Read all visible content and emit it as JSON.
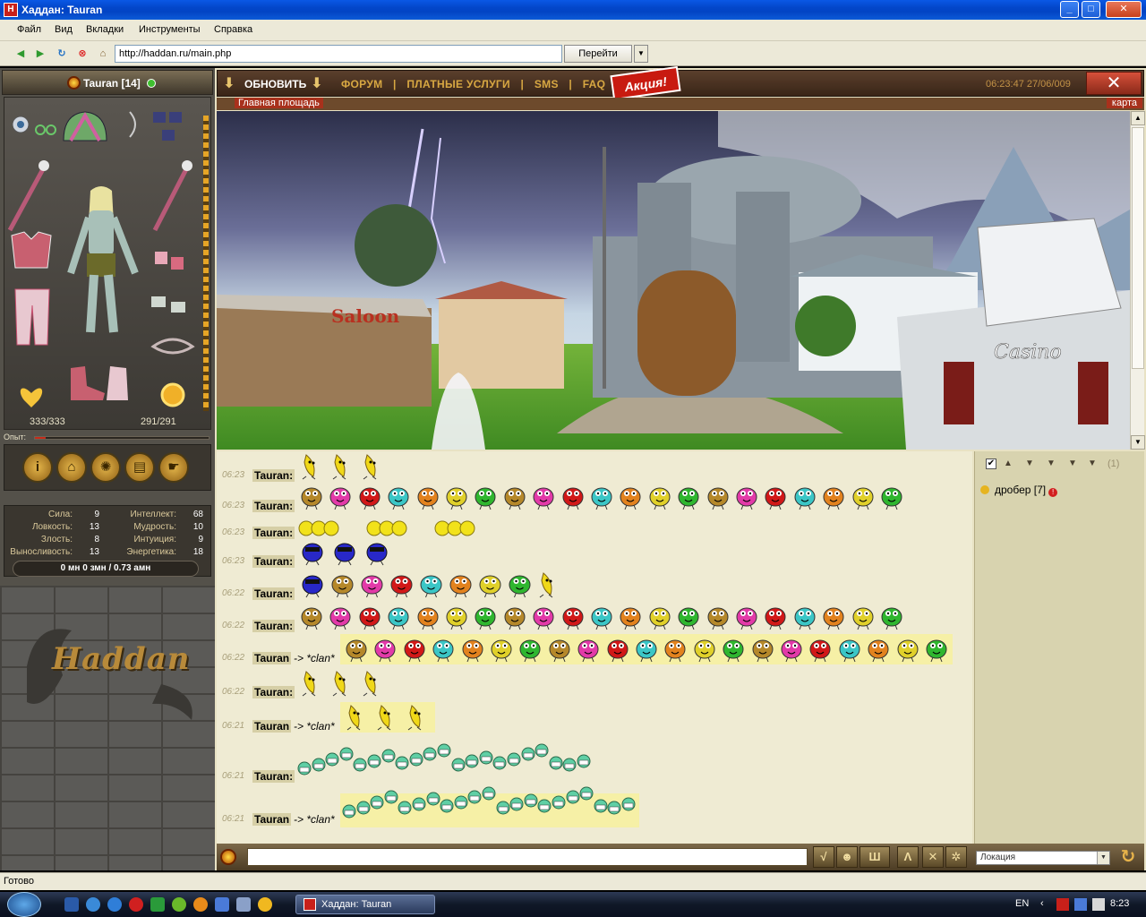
{
  "window": {
    "title": "Хаддан: Tauran",
    "app_icon": "H",
    "min_label": "_",
    "max_label": "□",
    "close_label": "✕"
  },
  "menu": [
    "Файл",
    "Вид",
    "Вкладки",
    "Инструменты",
    "Справка"
  ],
  "address": {
    "url": "http://haddan.ru/main.php",
    "go_label": "Перейти",
    "go_drop_label": "▼"
  },
  "nav_icons": [
    "back-icon",
    "forward-icon",
    "reload-icon",
    "stop-icon",
    "home-icon"
  ],
  "character": {
    "name": "Tauran [14]",
    "hp": "333/333",
    "mana": "291/291",
    "exp_label": "Опыт:",
    "exp_fraction": 0.06,
    "actions": [
      {
        "icon": "info-icon",
        "glyph": "i"
      },
      {
        "icon": "inventory-icon",
        "glyph": "⌂"
      },
      {
        "icon": "sun-icon",
        "glyph": "✺"
      },
      {
        "icon": "book-icon",
        "glyph": "▤"
      },
      {
        "icon": "hand-icon",
        "glyph": "☛"
      }
    ],
    "stats": [
      {
        "label": "Сила:",
        "value": "9"
      },
      {
        "label": "Ловкость:",
        "value": "13"
      },
      {
        "label": "Злость:",
        "value": "8"
      },
      {
        "label": "Выносливость:",
        "value": "13"
      },
      {
        "label": "Интеллект:",
        "value": "68"
      },
      {
        "label": "Мудрость:",
        "value": "10"
      },
      {
        "label": "Интуиция:",
        "value": "9"
      },
      {
        "label": "Энергетика:",
        "value": "18"
      }
    ],
    "money": "0 мн   0 змн / 0.73 амн",
    "logo": "Haddan"
  },
  "gamebar": {
    "refresh": "ОБНОВИТЬ",
    "arrow": "⬇",
    "links": [
      "ФОРУМ",
      "ПЛАТНЫЕ  УСЛУГИ",
      "SMS",
      "FAQ"
    ],
    "separator": "|",
    "promo": "Акция!",
    "time": "06:23:47   27/06/009",
    "close_glyph": "✕"
  },
  "location": {
    "name": "Главная площадь",
    "map_label": "карта"
  },
  "scene_labels": {
    "saloon": "Saloon",
    "casino": "Casino"
  },
  "chat": {
    "messages": [
      {
        "time": "06:23",
        "nick": "Tauran:",
        "to": "",
        "row": "bananas"
      },
      {
        "time": "06:23",
        "nick": "Tauran:",
        "to": "",
        "row": "creatures"
      },
      {
        "time": "06:23",
        "nick": "Tauran:",
        "to": "",
        "row": "lemons"
      },
      {
        "time": "06:23",
        "nick": "Tauran:",
        "to": "",
        "row": "blues"
      },
      {
        "time": "06:22",
        "nick": "Tauran:",
        "to": "",
        "row": "mixed"
      },
      {
        "time": "06:22",
        "nick": "Tauran:",
        "to": "",
        "row": "creatures"
      },
      {
        "time": "06:22",
        "nick": "Tauran",
        "to": "-> *clan*",
        "row": "creatures"
      },
      {
        "time": "06:22",
        "nick": "Tauran:",
        "to": "",
        "row": "bananas"
      },
      {
        "time": "06:21",
        "nick": "Tauran",
        "to": "-> *clan*",
        "row": "bananas"
      },
      {
        "time": "06:21",
        "nick": "Tauran:",
        "to": "",
        "row": "grins"
      },
      {
        "time": "06:21",
        "nick": "Tauran",
        "to": "-> *clan*",
        "row": "grins"
      }
    ],
    "colors": {
      "creature": [
        "#b5882a",
        "#e23aa8",
        "#d11818",
        "#3bc6c6",
        "#e2821e",
        "#e0d02a",
        "#2fb62f"
      ],
      "banana": "#f0d818",
      "lemon": "#f2e21a",
      "blue": "#2828c8",
      "grin": "#5fcfa5"
    }
  },
  "users": {
    "count": "(1)",
    "list": [
      {
        "name": "дробер [7]"
      }
    ],
    "checkbox": "✔",
    "alert": "!"
  },
  "input": {
    "tools": [
      {
        "name": "check-icon",
        "glyph": "√"
      },
      {
        "name": "smile-icon",
        "glyph": "☻"
      },
      {
        "name": "font-icon",
        "glyph": "Ш"
      },
      {
        "name": "translit-icon",
        "glyph": "Λ"
      },
      {
        "name": "clear-icon",
        "glyph": "✕"
      },
      {
        "name": "settings-icon",
        "glyph": "✲"
      }
    ],
    "channel": "Локация",
    "refresh_glyph": "↻"
  },
  "status": "Готово",
  "taskbar": {
    "task": "Хаддан: Tauran",
    "lang": "EN",
    "clock": "8:23"
  },
  "colors": {
    "accent": "#d8a842",
    "title_blue": "#0346c9"
  }
}
